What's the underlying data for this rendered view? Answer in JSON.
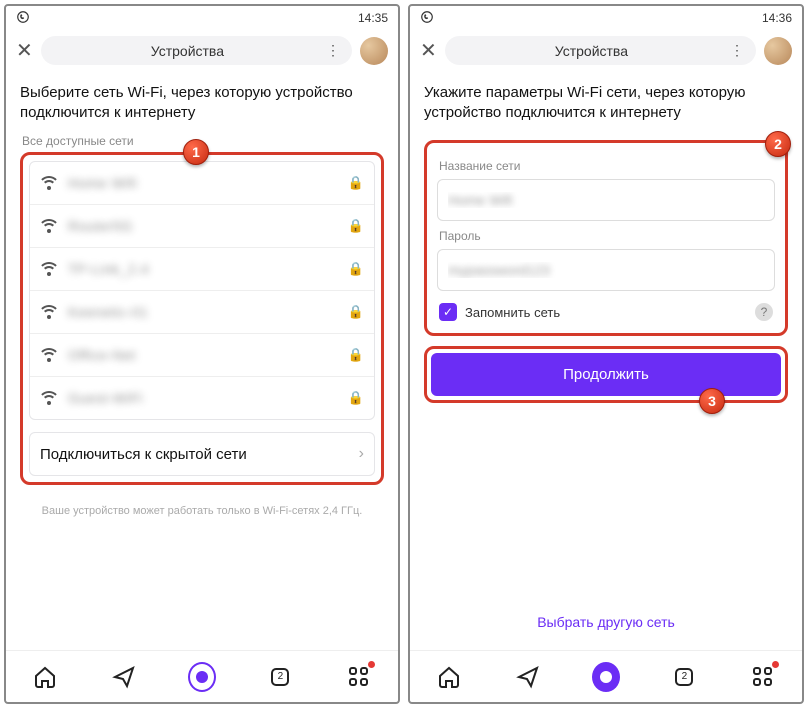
{
  "left": {
    "status_time": "14:35",
    "title": "Устройства",
    "heading": "Выберите сеть Wi-Fi, через которую устройство подключится к интернету",
    "subhead": "Все доступные сети",
    "networks": [
      {
        "name": "Home Wifi",
        "locked": true
      },
      {
        "name": "Router5G",
        "locked": true
      },
      {
        "name": "TP-Link_2.4",
        "locked": true
      },
      {
        "name": "Keenetic-01",
        "locked": true
      },
      {
        "name": "Office-Net",
        "locked": true
      },
      {
        "name": "Guest-WiFi",
        "locked": true
      }
    ],
    "hidden_row": "Подключиться к скрытой сети",
    "footnote": "Ваше устройство может работать только в Wi-Fi-сетях 2,4 ГГц.",
    "badge": "1",
    "nav_badge": "2"
  },
  "right": {
    "status_time": "14:36",
    "title": "Устройства",
    "heading": "Укажите параметры Wi-Fi сети, через которую устройство подключится к интернету",
    "field_name_label": "Название сети",
    "field_name_value": "Home Wifi",
    "field_pass_label": "Пароль",
    "field_pass_value": "mypassword123",
    "remember": "Запомнить сеть",
    "continue": "Продолжить",
    "other_link": "Выбрать другую сеть",
    "badge_form": "2",
    "badge_btn": "3",
    "nav_badge": "2"
  }
}
